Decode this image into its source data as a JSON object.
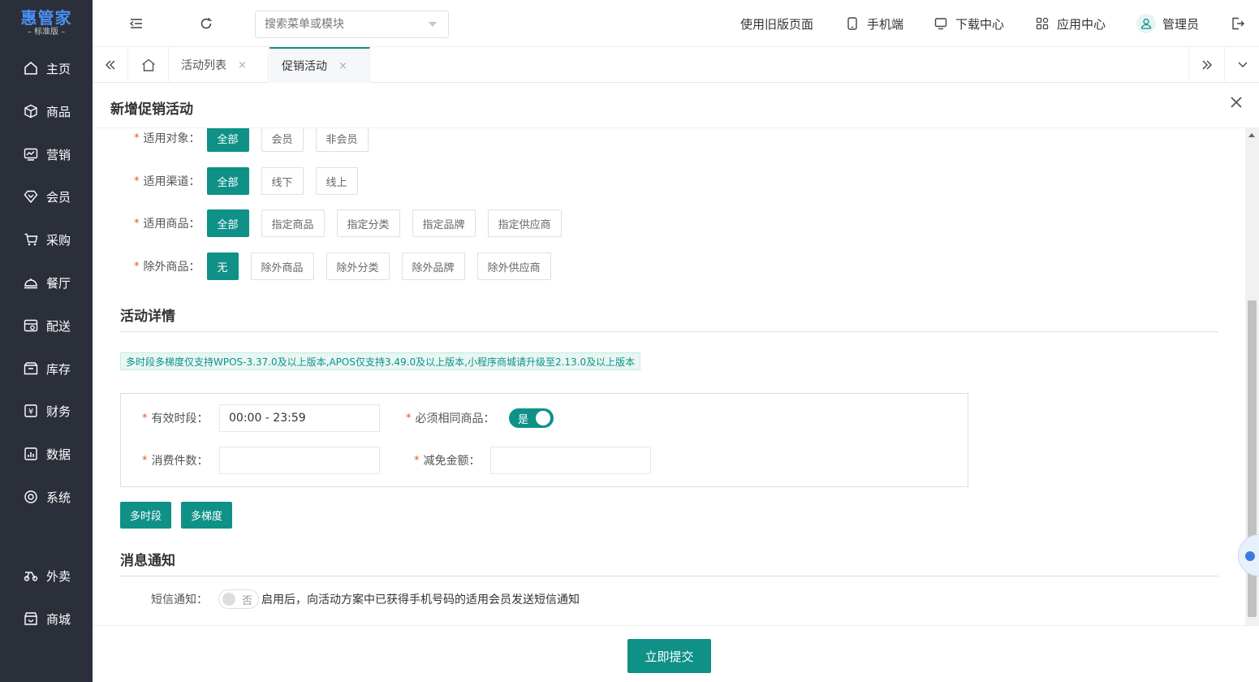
{
  "brand": {
    "name": "惠管家",
    "edition": "– 标准版 –",
    "accent": "#0f9188"
  },
  "sidebar": {
    "items": [
      {
        "label": "主页",
        "icon": "home-icon"
      },
      {
        "label": "商品",
        "icon": "box-icon"
      },
      {
        "label": "营销",
        "icon": "chart-icon"
      },
      {
        "label": "会员",
        "icon": "diamond-icon"
      },
      {
        "label": "采购",
        "icon": "cart-icon"
      },
      {
        "label": "餐厅",
        "icon": "dish-icon"
      },
      {
        "label": "配送",
        "icon": "delivery-icon"
      },
      {
        "label": "库存",
        "icon": "inventory-icon"
      },
      {
        "label": "财务",
        "icon": "finance-icon"
      },
      {
        "label": "数据",
        "icon": "data-icon"
      },
      {
        "label": "系统",
        "icon": "settings-icon"
      },
      {
        "label": "外卖",
        "icon": "bike-icon"
      },
      {
        "label": "商城",
        "icon": "shop-icon"
      }
    ]
  },
  "header": {
    "search_placeholder": "搜索菜单或模块",
    "links": {
      "old_page": "使用旧版页面",
      "mobile": "手机端",
      "download": "下载中心",
      "apps": "应用中心",
      "user": "管理员"
    }
  },
  "tabs": [
    {
      "label": "活动列表",
      "close": "×"
    },
    {
      "label": "促销活动",
      "close": "×"
    }
  ],
  "panel": {
    "title": "新增促销活动",
    "scope": {
      "target_label": "适用对象：",
      "target_options": [
        "全部",
        "会员",
        "非会员"
      ],
      "channel_label": "适用渠道：",
      "channel_options": [
        "全部",
        "线下",
        "线上"
      ],
      "goods_label": "适用商品：",
      "goods_options": [
        "全部",
        "指定商品",
        "指定分类",
        "指定品牌",
        "指定供应商"
      ],
      "exclude_label": "除外商品：",
      "exclude_options": [
        "无",
        "除外商品",
        "除外分类",
        "除外品牌",
        "除外供应商"
      ]
    },
    "details": {
      "title": "活动详情",
      "notice": "多时段多梯度仅支持WPOS-3.37.0及以上版本,APOS仅支持3.49.0及以上版本,小程序商城请升级至2.13.0及以上版本",
      "time_label": "有效时段：",
      "time_value": "00:00 - 23:59",
      "same_goods_label": "必须相同商品：",
      "same_goods_value": "是",
      "count_label": "消费件数：",
      "discount_label": "减免金额：",
      "multi_period_btn": "多时段",
      "multi_tier_btn": "多梯度"
    },
    "notify": {
      "title": "消息通知",
      "sms_label": "短信通知：",
      "sms_value": "否",
      "sms_desc": "启用后，向活动方案中已获得手机号码的适用会员发送短信通知"
    },
    "submit": "立即提交"
  }
}
